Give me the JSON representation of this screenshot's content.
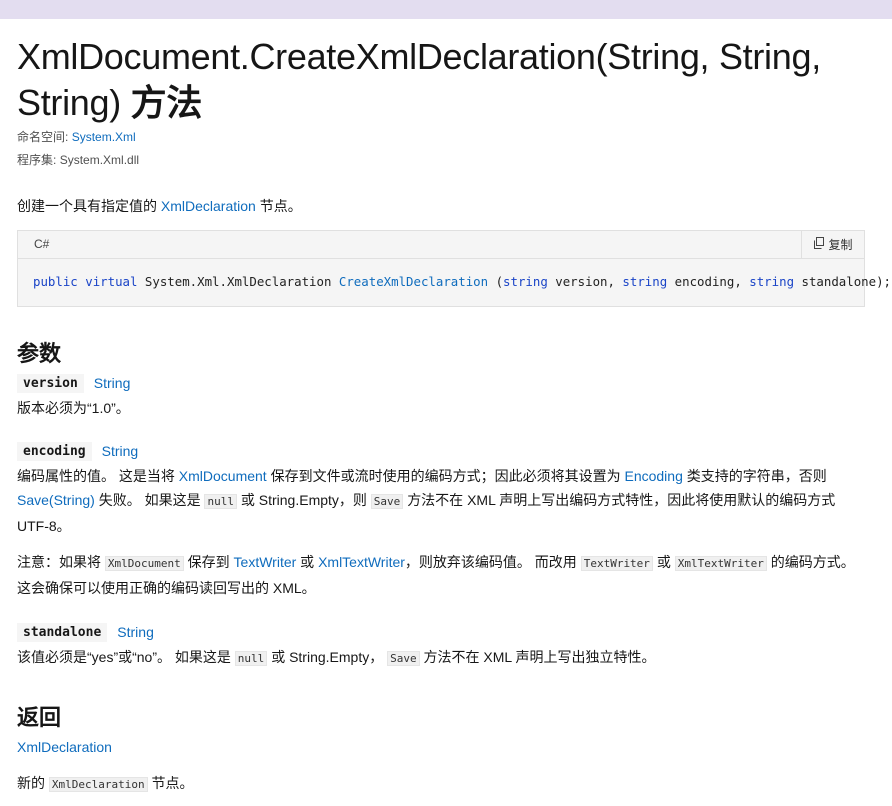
{
  "page": {
    "title_line1": "XmlDocument.CreateXmlDeclaration(String, String,",
    "title_line2": "String)",
    "title_suffix": "方法",
    "namespace_label": "命名空间:",
    "namespace_value": "System.Xml",
    "assembly_label": "程序集:",
    "assembly_value": "System.Xml.dll"
  },
  "summary": {
    "pre": "创建一个具有指定值的",
    "link": "XmlDeclaration",
    "post": "节点。"
  },
  "code": {
    "language": "C#",
    "copy_label": "复制",
    "copy_icon": "copy-icon",
    "kw_public": "public",
    "kw_virtual": "virtual",
    "return_type": "System.Xml.XmlDeclaration",
    "method": "CreateXmlDeclaration",
    "open": "(",
    "kw_string": "string",
    "p1": "version,",
    "p2": "encoding,",
    "p3": "standalone);"
  },
  "params_heading": "参数",
  "params": {
    "version": {
      "name": "version",
      "type": "String",
      "desc": "版本必须为“1.0”。"
    },
    "encoding": {
      "name": "encoding",
      "type": "String",
      "d1": "编码属性的值。 这是当将",
      "d1_link": "XmlDocument",
      "d2": "保存到文件或流时使用的编码方式；因此必须将其设置为",
      "d2_link": "Encoding",
      "d3": "类支持的字符串，否则",
      "d4_link": "Save(String)",
      "d4": "失败。 如果这是",
      "code_null": "null",
      "d5": "或 String.Empty，则",
      "code_save": "Save",
      "d6": "方法不在 XML 声明上写出编码方式特性，因此将使用默认的编码方式 UTF-8。",
      "n1": "注意：如果将",
      "n_code_doc": "XmlDocument",
      "n2": "保存到",
      "n_link_tw": "TextWriter",
      "n3": "或",
      "n_link_xtw": "XmlTextWriter",
      "n4": "，则放弃该编码值。 而改用",
      "n_code_tw": "TextWriter",
      "n5": "或",
      "n_code_xtw": "XmlTextWriter",
      "n6": "的编码方式。 这会确保可以使用正确的编码读回写出的 XML。"
    },
    "standalone": {
      "name": "standalone",
      "type": "String",
      "s1": "该值必须是“yes”或“no”。 如果这是",
      "code_null": "null",
      "s2": "或 String.Empty，",
      "code_save": "Save",
      "s3": "方法不在 XML 声明上写出独立特性。"
    }
  },
  "returns_heading": "返回",
  "returns": {
    "type": "XmlDeclaration",
    "pre": "新的",
    "code": "XmlDeclaration",
    "post": "节点。"
  }
}
